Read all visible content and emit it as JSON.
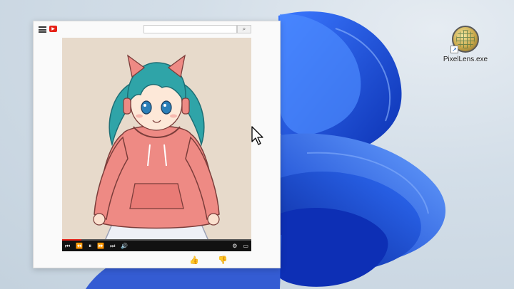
{
  "desktop": {
    "icon": {
      "label": "PixelLens.exe",
      "name": "pixellens-app-icon"
    }
  },
  "player": {
    "progress": 0.1,
    "controls": {
      "prev": "⏮",
      "rewind": "⏪",
      "pause": "⏸",
      "forward": "⏩",
      "next": "⏭",
      "volume": "🔊",
      "settings": "⚙",
      "miniplayer": "▭"
    }
  },
  "actions": {
    "like": "👍",
    "dislike": "👎"
  },
  "search": {
    "button": "⌕"
  },
  "colors": {
    "accent": "#e62117",
    "wallpaper": "#1a4fd6",
    "hoodie": "#ee8a84",
    "hair": "#2fa4a8"
  }
}
